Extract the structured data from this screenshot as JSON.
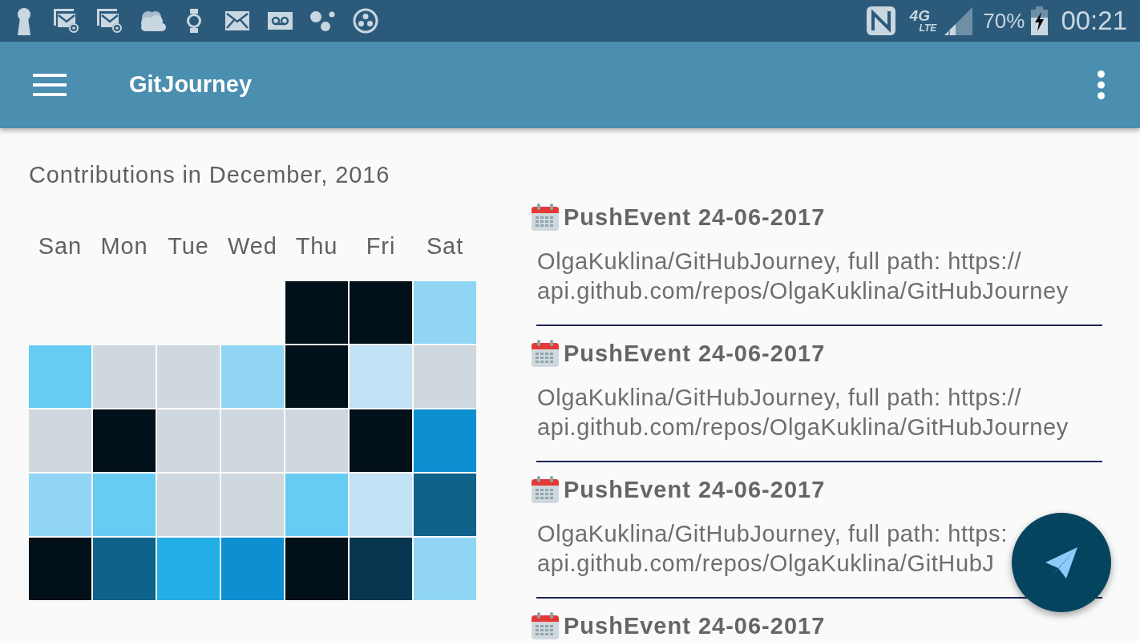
{
  "status_bar": {
    "network": {
      "generation": "4G",
      "technology": "LTE"
    },
    "battery": "70%",
    "charging": true,
    "time": "00:21"
  },
  "app_bar": {
    "title": "GitJourney"
  },
  "contributions": {
    "title": "Contributions in December, 2016",
    "weekdays": [
      "San",
      "Mon",
      "Tue",
      "Wed",
      "Thu",
      "Fri",
      "Sat"
    ],
    "weeks": [
      {
        "days": [
          {
            "kind": "empty"
          },
          {
            "kind": "empty"
          },
          {
            "kind": "empty"
          },
          {
            "kind": "empty"
          },
          {
            "kind": "day",
            "color": "#021019"
          },
          {
            "kind": "day",
            "color": "#021019"
          },
          {
            "kind": "day",
            "color": "#90d5f4"
          }
        ]
      },
      {
        "days": [
          {
            "kind": "day",
            "color": "#66ccf4"
          },
          {
            "kind": "day",
            "color": "#cfd8de"
          },
          {
            "kind": "day",
            "color": "#cfd8de"
          },
          {
            "kind": "day",
            "color": "#90d5f4"
          },
          {
            "kind": "day",
            "color": "#021019"
          },
          {
            "kind": "day",
            "color": "#c2e2f5"
          },
          {
            "kind": "day",
            "color": "#cfd8de"
          }
        ]
      },
      {
        "days": [
          {
            "kind": "day",
            "color": "#cfd8de"
          },
          {
            "kind": "day",
            "color": "#021019"
          },
          {
            "kind": "day",
            "color": "#cfd8de"
          },
          {
            "kind": "day",
            "color": "#cfd8de"
          },
          {
            "kind": "day",
            "color": "#cfd8de"
          },
          {
            "kind": "day",
            "color": "#021019"
          },
          {
            "kind": "day",
            "color": "#0d8fd1"
          }
        ]
      },
      {
        "days": [
          {
            "kind": "day",
            "color": "#90d5f4"
          },
          {
            "kind": "day",
            "color": "#66ccf4"
          },
          {
            "kind": "day",
            "color": "#cfd8de"
          },
          {
            "kind": "day",
            "color": "#cfd8de"
          },
          {
            "kind": "day",
            "color": "#66ccf4"
          },
          {
            "kind": "day",
            "color": "#c2e2f5"
          },
          {
            "kind": "day",
            "color": "#0f6289"
          }
        ]
      },
      {
        "days": [
          {
            "kind": "day",
            "color": "#021019"
          },
          {
            "kind": "day",
            "color": "#0f6289"
          },
          {
            "kind": "day",
            "color": "#24aee6"
          },
          {
            "kind": "day",
            "color": "#0d8fd1"
          },
          {
            "kind": "day",
            "color": "#021019"
          },
          {
            "kind": "day",
            "color": "#083650"
          },
          {
            "kind": "day",
            "color": "#90d5f4"
          }
        ]
      }
    ]
  },
  "events": [
    {
      "title": "PushEvent 24-06-2017",
      "body_lines": [
        "OlgaKuklina/GitHubJourney, full path: https://",
        "api.github.com/repos/OlgaKuklina/GitHubJourney"
      ]
    },
    {
      "title": "PushEvent 24-06-2017",
      "body_lines": [
        "OlgaKuklina/GitHubJourney, full path: https://",
        "api.github.com/repos/OlgaKuklina/GitHubJourney"
      ]
    },
    {
      "title": "PushEvent 24-06-2017",
      "body_lines": [
        "OlgaKuklina/GitHubJourney, full path: https:",
        "api.github.com/repos/OlgaKuklina/GitHubJ"
      ]
    },
    {
      "title": "PushEvent 24-06-2017"
    }
  ]
}
